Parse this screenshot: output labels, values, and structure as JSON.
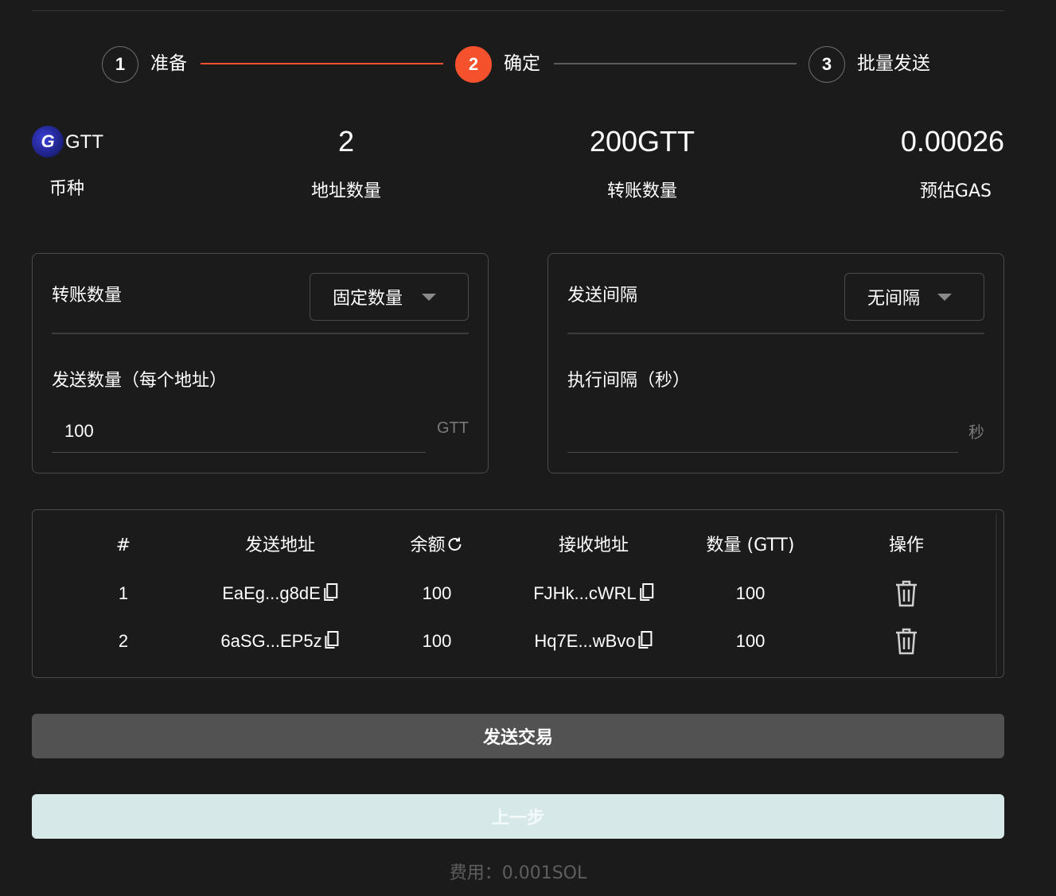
{
  "stepper": {
    "steps": [
      {
        "number": "1",
        "label": "准备"
      },
      {
        "number": "2",
        "label": "确定"
      },
      {
        "number": "3",
        "label": "批量发送"
      }
    ],
    "active_step": 2,
    "colors": {
      "active": "#f4512c",
      "inactive_line": "#5a5a5a"
    }
  },
  "summary": {
    "token": {
      "logo_letter": "G",
      "name": "GTT",
      "label": "币种"
    },
    "address_count": {
      "value": "2",
      "label": "地址数量"
    },
    "transfer_amount": {
      "value": "200GTT",
      "label": "转账数量"
    },
    "estimated_gas": {
      "value": "0.00026",
      "label": "预估GAS"
    }
  },
  "amount_panel": {
    "title": "转账数量",
    "mode_select": "固定数量",
    "field_label": "发送数量（每个地址）",
    "field_value": "100",
    "unit": "GTT"
  },
  "interval_panel": {
    "title": "发送间隔",
    "mode_select": "无间隔",
    "field_label": "执行间隔（秒）",
    "field_value": "",
    "unit": "秒"
  },
  "table": {
    "headers": [
      "#",
      "发送地址",
      "余额",
      "接收地址",
      "数量 (GTT)",
      "操作"
    ],
    "rows": [
      {
        "index": "1",
        "from": "EaEg...g8dE",
        "balance": "100",
        "to": "FJHk...cWRL",
        "amount": "100"
      },
      {
        "index": "2",
        "from": "6aSG...EP5z",
        "balance": "100",
        "to": "Hq7E...wBvo",
        "amount": "100"
      }
    ]
  },
  "actions": {
    "send_label": "发送交易",
    "prev_label": "上一步",
    "fee_text": "费用：0.001SOL"
  }
}
